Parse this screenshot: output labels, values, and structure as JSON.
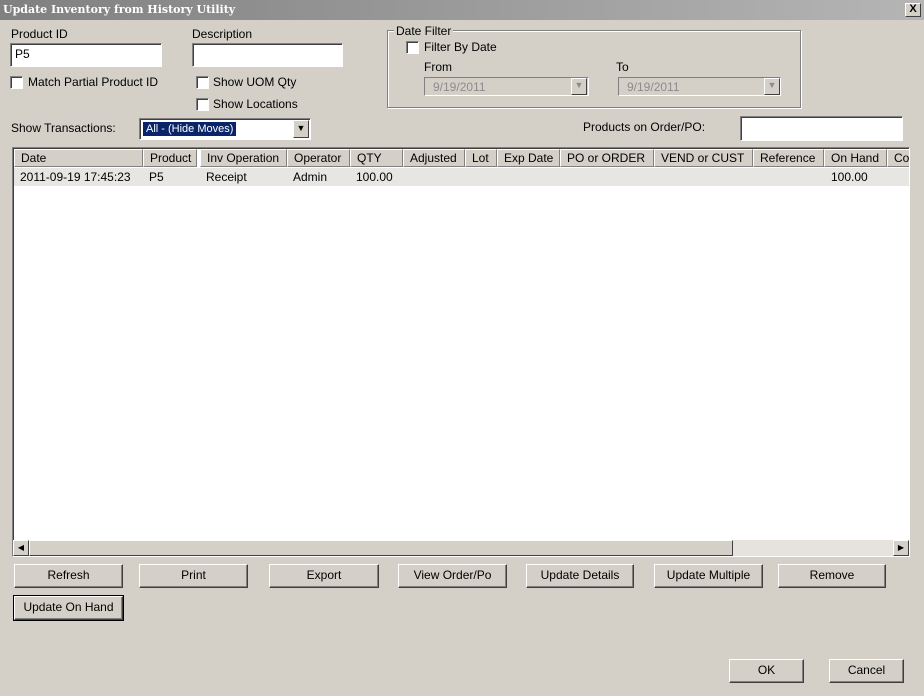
{
  "window": {
    "title": "Update Inventory from History Utility",
    "close_glyph": "X"
  },
  "product_id": {
    "label": "Product ID",
    "value": "P5"
  },
  "description": {
    "label": "Description",
    "value": ""
  },
  "checkboxes": {
    "match_partial": "Match Partial Product ID",
    "show_uom_qty": "Show UOM Qty",
    "show_locations": "Show Locations"
  },
  "date_filter": {
    "legend": "Date Filter",
    "filter_by_date": "Filter By Date",
    "from_label": "From",
    "from_value": "9/19/2011",
    "to_label": "To",
    "to_value": "9/19/2011"
  },
  "show_transactions": {
    "label": "Show Transactions:",
    "selected": "All - (Hide Moves)"
  },
  "products_on_order": {
    "label": "Products on Order/PO:",
    "value": ""
  },
  "grid": {
    "columns": [
      "Date",
      "Product",
      "Inv Operation",
      "Operator",
      "QTY",
      "Adjusted",
      "Lot",
      "Exp Date",
      "PO or ORDER",
      "VEND or CUST",
      "Reference",
      "On Hand",
      "Co"
    ],
    "rows": [
      {
        "date": "2011-09-19 17:45:23",
        "product": "P5",
        "inv_operation": "Receipt",
        "operator": "Admin",
        "qty": "100.00",
        "on_hand": "100.00"
      }
    ]
  },
  "buttons": {
    "refresh": "Refresh",
    "print": "Print",
    "export": "Export",
    "view_order": "View Order/Po",
    "update_details": "Update Details",
    "update_multiple": "Update Multiple",
    "remove": "Remove",
    "update_on_hand": "Update On Hand",
    "ok": "OK",
    "cancel": "Cancel"
  },
  "icons": {
    "dropdown": "chevron-down-icon",
    "scroll_left": "arrow-left-icon",
    "scroll_right": "arrow-right-icon"
  }
}
